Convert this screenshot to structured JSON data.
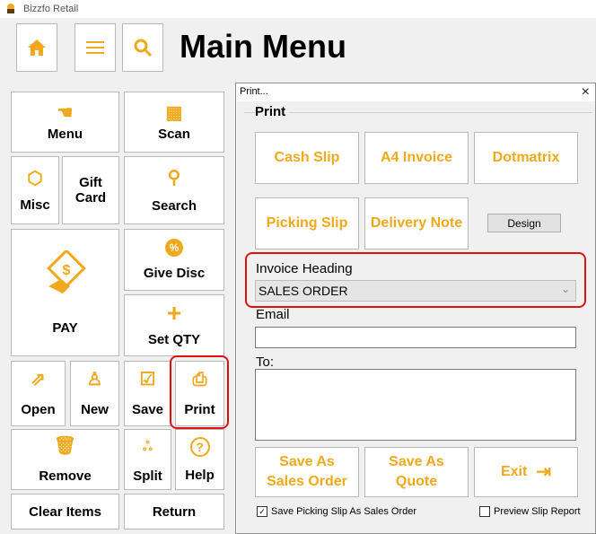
{
  "app": {
    "title": "Bizzfo Retail"
  },
  "header": {
    "title": "Main Menu",
    "home_icon": "home-icon",
    "list_icon": "list-icon",
    "search_icon": "search-icon"
  },
  "tiles": {
    "menu": "Menu",
    "scan": "Scan",
    "misc": "Misc",
    "gift_card": "Gift\nCard",
    "search": "Search",
    "give_disc": "Give Disc",
    "pay": "PAY",
    "set_qty": "Set QTY",
    "open": "Open",
    "new": "New",
    "save": "Save",
    "print": "Print",
    "remove": "Remove",
    "split": "Split",
    "help": "Help",
    "clear_items": "Clear Items",
    "return": "Return"
  },
  "dialog": {
    "title": "Print...",
    "close": "×",
    "group_label": "Print",
    "buttons": {
      "cash_slip": "Cash Slip",
      "a4_invoice": "A4 Invoice",
      "dotmatrix": "Dotmatrix",
      "picking_slip": "Picking Slip",
      "delivery_note": "Delivery Note",
      "design": "Design",
      "save_sales_order": "Save As\nSales Order",
      "save_quote": "Save As\nQuote",
      "exit": "Exit"
    },
    "invoice_heading_label": "Invoice Heading",
    "invoice_heading_value": "SALES ORDER",
    "email_label": "Email",
    "email_value": "",
    "to_label": "To:",
    "to_value": "",
    "checkbox_save_picking": "Save Picking Slip As Sales Order",
    "checkbox_save_picking_checked": true,
    "checkbox_preview": "Preview Slip Report",
    "checkbox_preview_checked": false
  },
  "colors": {
    "accent": "#f0a81c",
    "highlight": "#e01010"
  }
}
